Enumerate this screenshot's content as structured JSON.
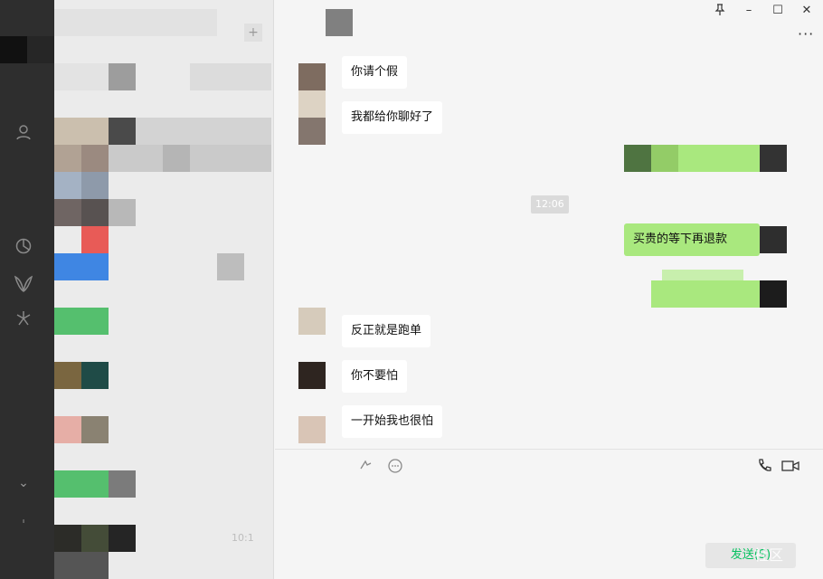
{
  "window": {
    "pin_icon": "pin-icon",
    "minimize_label": "–",
    "maximize_label": "☐",
    "close_label": "✕",
    "more_label": "···"
  },
  "sidebar": {
    "icons": [
      "contacts-icon",
      "moments-icon",
      "mini-program-icon",
      "discover-icon",
      "phone-icon",
      "menu-icon"
    ]
  },
  "chat_list": {
    "add_label": "+",
    "last_time": "10:1"
  },
  "messages": [
    {
      "side": "in",
      "text": "你请个假"
    },
    {
      "side": "in",
      "text": "我都给你聊好了"
    },
    {
      "side": "out",
      "text": ""
    },
    {
      "side": "time",
      "text": "12:06"
    },
    {
      "side": "out",
      "text": "买贵的等下再退款"
    },
    {
      "side": "out",
      "text": ""
    },
    {
      "side": "in",
      "text": "反正就是跑单"
    },
    {
      "side": "in",
      "text": "你不要怕"
    },
    {
      "side": "in",
      "text": "一开始我也很怕"
    }
  ],
  "composer": {
    "send_label": "发送(S)",
    "watermark": "社区"
  },
  "colors": {
    "accent": "#07c160",
    "bubble_out": "#a9e87e",
    "nav_bg": "#2e2e2e"
  }
}
